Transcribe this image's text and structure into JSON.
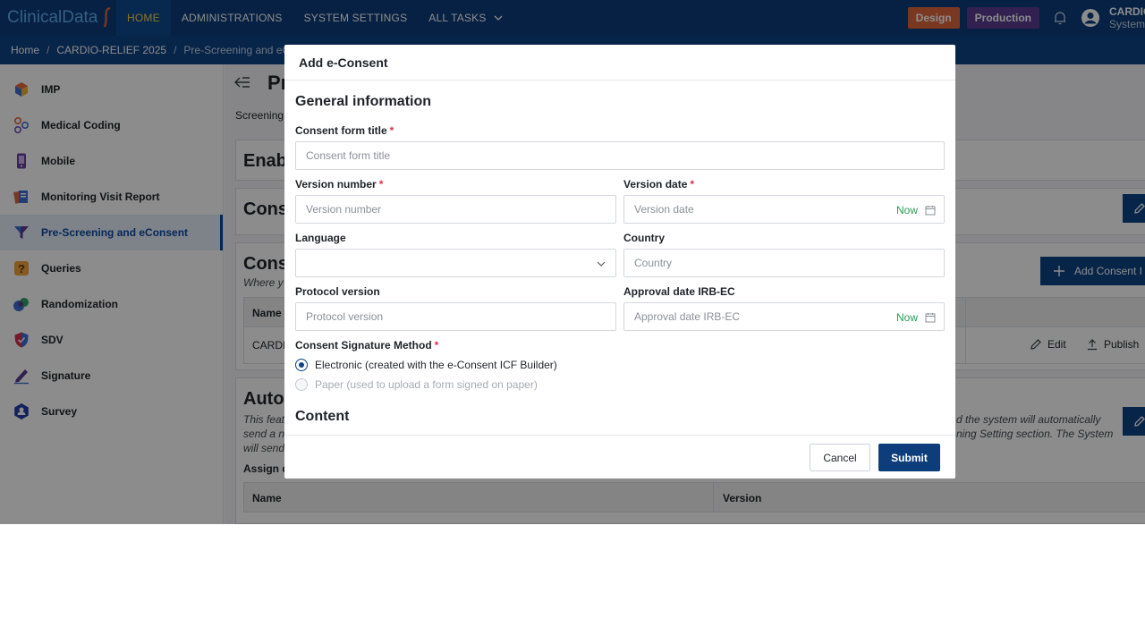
{
  "topbar": {
    "logo_text": "ClinicalData",
    "nav": [
      {
        "label": "HOME",
        "active": true
      },
      {
        "label": "ADMINISTRATIONS",
        "active": false
      },
      {
        "label": "SYSTEM SETTINGS",
        "active": false
      },
      {
        "label": "ALL TASKS",
        "active": false
      }
    ],
    "badge_design": "Design",
    "badge_production": "Production",
    "user_name": "CARDIO",
    "user_role": "System"
  },
  "breadcrumb": [
    "Home",
    "CARDIO-RELIEF 2025",
    "Pre-Screening and eC"
  ],
  "sidebar": {
    "items": [
      {
        "label": "IMP",
        "icon": "cube-icon"
      },
      {
        "label": "Medical Coding",
        "icon": "coding-icon"
      },
      {
        "label": "Mobile",
        "icon": "mobile-icon"
      },
      {
        "label": "Monitoring Visit Report",
        "icon": "report-icon"
      },
      {
        "label": "Pre-Screening and eConsent",
        "icon": "funnel-icon",
        "active": true
      },
      {
        "label": "Queries",
        "icon": "question-icon"
      },
      {
        "label": "Randomization",
        "icon": "randomization-icon"
      },
      {
        "label": "SDV",
        "icon": "shield-icon"
      },
      {
        "label": "Signature",
        "icon": "signature-icon"
      },
      {
        "label": "Survey",
        "icon": "survey-icon"
      }
    ]
  },
  "main": {
    "title": "Pr",
    "subtab": "Screening",
    "card1_title": "Enab",
    "card2_title": "Cons",
    "card3_title": "Cons",
    "card3_desc": "Where y",
    "card3_col_name": "Name",
    "card3_row_name": "CARDIO",
    "card3_add_label": "Add Consent I",
    "card3_edit_label": "Edit",
    "card3_publish_label": "Publish",
    "card4_title": "Auto",
    "card4_desc_l1": "This feat",
    "card4_desc_l2": "send a n",
    "card4_desc_l3": "will send",
    "card4_desc_r1": "d the system will automatically",
    "card4_desc_r2": "ning Setting section. The System",
    "assign_label": "Assign d",
    "table_col_name": "Name",
    "table_col_version": "Version"
  },
  "modal": {
    "title": "Add e-Consent",
    "section_general": "General information",
    "consent_title_label": "Consent form title",
    "consent_title_placeholder": "Consent form title",
    "version_number_label": "Version number",
    "version_number_placeholder": "Version number",
    "version_date_label": "Version date",
    "version_date_placeholder": "Version date",
    "now_label": "Now",
    "language_label": "Language",
    "country_label": "Country",
    "country_placeholder": "Country",
    "protocol_label": "Protocol version",
    "protocol_placeholder": "Protocol version",
    "approval_label": "Approval date IRB-EC",
    "approval_placeholder": "Approval date IRB-EC",
    "signature_method_label": "Consent Signature Method",
    "radio_electronic": "Electronic (created with the e-Consent ICF Builder)",
    "radio_paper": "Paper (used to upload a form signed on paper)",
    "section_content": "Content",
    "cancel_label": "Cancel",
    "submit_label": "Submit"
  }
}
